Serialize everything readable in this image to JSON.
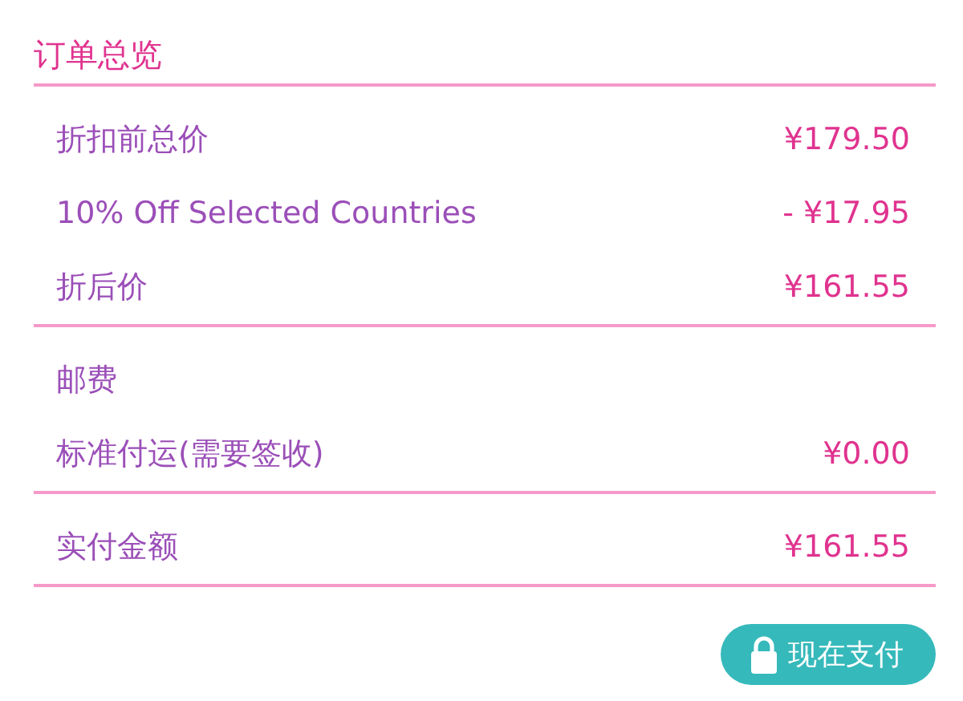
{
  "title": "订单总览",
  "sections": [
    {
      "rows": [
        {
          "label": "折扣前总价",
          "amount": "¥179.50"
        },
        {
          "label": "10% Off Selected Countries",
          "amount": "- ¥17.95"
        },
        {
          "label": "折后价",
          "amount": "¥161.55"
        }
      ]
    },
    {
      "rows": [
        {
          "label": "邮费"
        },
        {
          "label": "标准付运(需要签收)",
          "amount": "¥0.00"
        }
      ]
    },
    {
      "rows": [
        {
          "label": "实付金额",
          "amount": "¥161.55"
        }
      ]
    }
  ],
  "pay_button": {
    "label": "现在支付"
  }
}
